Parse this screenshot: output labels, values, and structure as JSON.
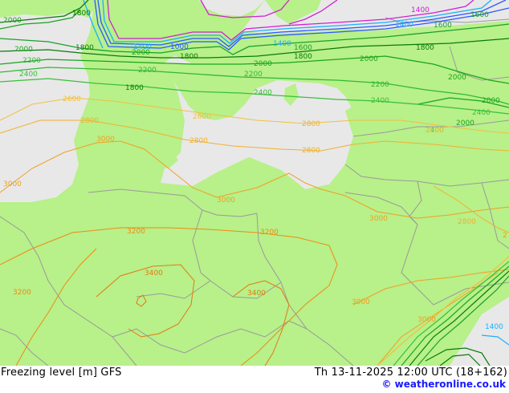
{
  "map": {
    "land_color": "#b8f08a",
    "sea_color": "#e8e8e8",
    "border_color": "#9a9a9a",
    "contour_colors": {
      "1000": "#2a58ff",
      "1400": "#1ab0ff",
      "1600": "#1aa02a",
      "1800": "#0a7a0a",
      "2000": "#1aa61a",
      "2200": "#32b832",
      "2400": "#39c039",
      "2600": "#f0c040",
      "2800": "#f0b030",
      "3000": "#f0a020",
      "3200": "#f08a10",
      "3400": "#e87810",
      "high_upper": "#d020d0"
    },
    "labels": [
      {
        "text": "2000",
        "color": "#1aa61a"
      },
      {
        "text": "1800",
        "color": "#0a7a0a"
      },
      {
        "text": "2000",
        "color": "#1aa61a"
      },
      {
        "text": "1800",
        "color": "#0a7a0a"
      },
      {
        "text": "2200",
        "color": "#32b832"
      },
      {
        "text": "1400",
        "color": "#1ab0ff"
      },
      {
        "text": "2000",
        "color": "#1aa61a"
      },
      {
        "text": "1000",
        "color": "#2a58ff"
      },
      {
        "text": "1800",
        "color": "#0a7a0a"
      },
      {
        "text": "1400",
        "color": "#1ab0ff"
      },
      {
        "text": "1600",
        "color": "#1aa02a"
      },
      {
        "text": "1800",
        "color": "#0a7a0a"
      },
      {
        "text": "1400",
        "color": "#d020d0"
      },
      {
        "text": "1400",
        "color": "#1ab0ff"
      },
      {
        "text": "1600",
        "color": "#1aa02a"
      },
      {
        "text": "1800",
        "color": "#0a7a0a"
      },
      {
        "text": "1600",
        "color": "#1aa02a"
      },
      {
        "text": "2400",
        "color": "#39c039"
      },
      {
        "text": "2200",
        "color": "#32b832"
      },
      {
        "text": "2000",
        "color": "#1aa61a"
      },
      {
        "text": "2200",
        "color": "#32b832"
      },
      {
        "text": "2000",
        "color": "#1aa61a"
      },
      {
        "text": "2000",
        "color": "#1aa61a"
      },
      {
        "text": "1800",
        "color": "#0a7a0a"
      },
      {
        "text": "2400",
        "color": "#39c039"
      },
      {
        "text": "2400",
        "color": "#39c039"
      },
      {
        "text": "2200",
        "color": "#32b832"
      },
      {
        "text": "2000",
        "color": "#1aa61a"
      },
      {
        "text": "2400",
        "color": "#39c039"
      },
      {
        "text": "2000",
        "color": "#1aa61a"
      },
      {
        "text": "2400",
        "color": "#39c039"
      },
      {
        "text": "2600",
        "color": "#f0c040"
      },
      {
        "text": "2600",
        "color": "#f0c040"
      },
      {
        "text": "2800",
        "color": "#f0b030"
      },
      {
        "text": "3000",
        "color": "#f0a020"
      },
      {
        "text": "2800",
        "color": "#f0b030"
      },
      {
        "text": "2800",
        "color": "#f0b030"
      },
      {
        "text": "2800",
        "color": "#f0b030"
      },
      {
        "text": "2600",
        "color": "#f0c040"
      },
      {
        "text": "3000",
        "color": "#f0a020"
      },
      {
        "text": "3000",
        "color": "#f0a020"
      },
      {
        "text": "3000",
        "color": "#f0a020"
      },
      {
        "text": "2800",
        "color": "#f0b030"
      },
      {
        "text": "3200",
        "color": "#f08a10"
      },
      {
        "text": "3200",
        "color": "#f08a10"
      },
      {
        "text": "3400",
        "color": "#e87810"
      },
      {
        "text": "3200",
        "color": "#f08a10"
      },
      {
        "text": "3400",
        "color": "#e87810"
      },
      {
        "text": "3000",
        "color": "#f0a020"
      },
      {
        "text": "3000",
        "color": "#f0a020"
      },
      {
        "text": "1400",
        "color": "#1ab0ff"
      },
      {
        "text": "2",
        "color": "#f0a020"
      }
    ]
  },
  "footer": {
    "title": "Freezing level [m] GFS",
    "time": "Th 13-11-2025 12:00 UTC (18+162)",
    "credit": "© weatheronline.co.uk"
  }
}
